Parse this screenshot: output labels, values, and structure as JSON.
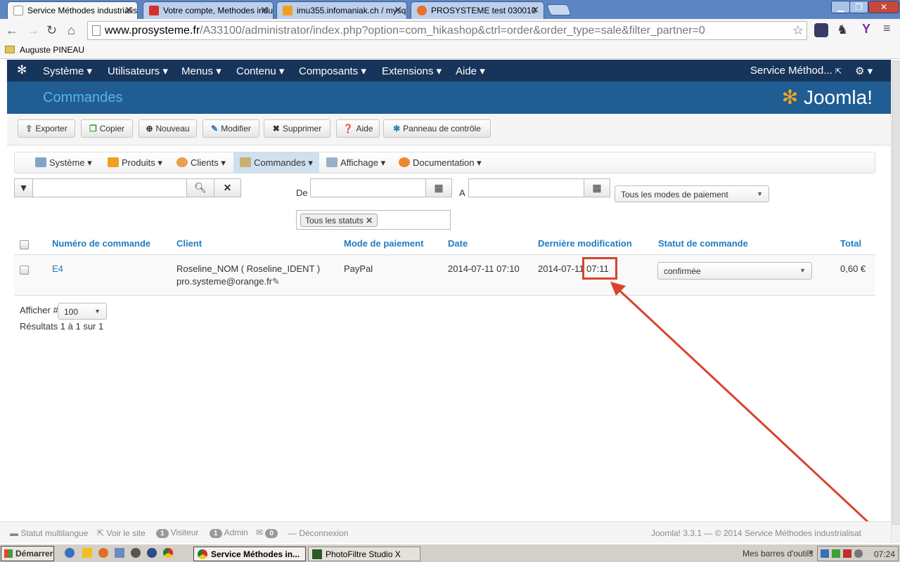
{
  "browser": {
    "tabs": [
      {
        "title": "Service Méthodes industrialis",
        "active": true,
        "icon": "page-icon"
      },
      {
        "title": "Votre compte, Methodes indu",
        "active": false,
        "icon": "account-icon"
      },
      {
        "title": "imu355.infomaniak.ch / mysq",
        "active": false,
        "icon": "phpmyadmin-icon"
      },
      {
        "title": "PROSYSTEME test 030010",
        "active": false,
        "icon": "joomla-icon"
      }
    ],
    "url_host": "www.prosysteme.fr",
    "url_path": "/A33100/administrator/index.php?option=com_hikashop&ctrl=order&order_type=sale&filter_partner=0",
    "bookmark": "Auguste PINEAU"
  },
  "joomla": {
    "menu": [
      "Système",
      "Utilisateurs",
      "Menus",
      "Contenu",
      "Composants",
      "Extensions",
      "Aide"
    ],
    "site_link": "Service Méthod...",
    "page_title": "Commandes",
    "logo": "Joomla!",
    "toolbar": {
      "export": "Exporter",
      "copy": "Copier",
      "new": "Nouveau",
      "edit": "Modifier",
      "delete": "Supprimer",
      "help": "Aide",
      "control_panel": "Panneau de contrôle"
    },
    "submenu": [
      "Système",
      "Produits",
      "Clients",
      "Commandes",
      "Affichage",
      "Documentation"
    ],
    "filters": {
      "from_label": "De",
      "to_label": "A",
      "payment_select": "Tous les modes de paiement",
      "status_tag": "Tous les statuts"
    },
    "table": {
      "headers": [
        "Numéro de commande",
        "Client",
        "Mode de paiement",
        "Date",
        "Dernière modification",
        "Statut de commande",
        "Total"
      ],
      "rows": [
        {
          "number": "E4",
          "client_name": "Roseline_NOM ( Roseline_IDENT )",
          "client_email": "pro.systeme@orange.fr",
          "payment": "PayPal",
          "date": "2014-07-11 07:10",
          "modified_date": "2014-07-11",
          "modified_time": "07:11",
          "status": "confirmée",
          "total": "0,60 €"
        }
      ]
    },
    "pagination": {
      "show_label": "Afficher #",
      "show_value": "100",
      "results": "Résultats 1 à 1 sur 1"
    },
    "footer": {
      "multilang": "Statut multilangue",
      "view_site": "Voir le site",
      "visitors_count": "1",
      "visitors_label": "Visiteur",
      "admin_count": "1",
      "admin_label": "Admin",
      "messages_count": "0",
      "logout": "Déconnexion",
      "copyright": "Joomla! 3.3.1 — © 2014 Service Méthodes industrialisat"
    }
  },
  "taskbar": {
    "start": "Démarrer",
    "tasks": [
      "Service Méthodes in...",
      "PhotoFiltre Studio X"
    ],
    "toolbars": "Mes barres d'outils",
    "clock": "07:24"
  },
  "colors": {
    "nav_bg": "#17345a",
    "header_bg": "#1f5d93",
    "link": "#1f7bc1",
    "annotation": "#d9432a"
  }
}
